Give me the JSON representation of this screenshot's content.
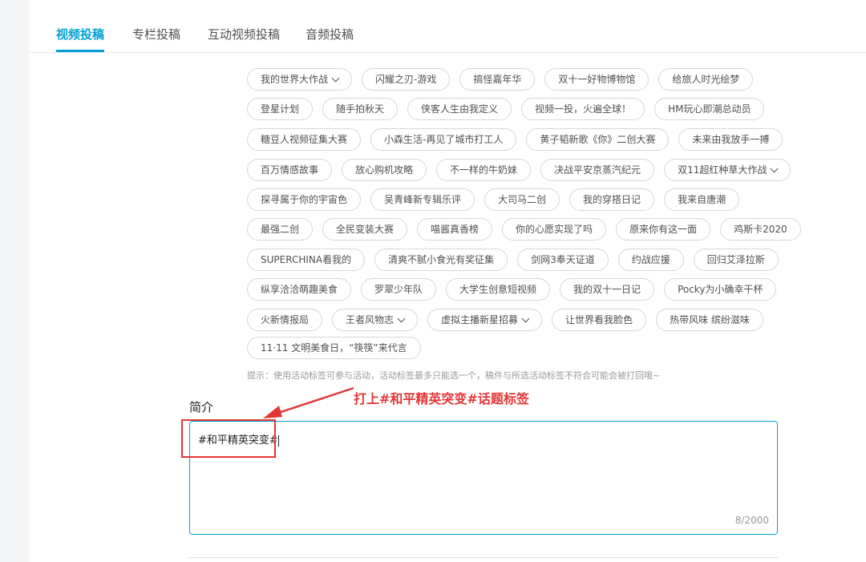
{
  "tabs": [
    {
      "label": "视频投稿"
    },
    {
      "label": "专栏投稿"
    },
    {
      "label": "互动视频投稿"
    },
    {
      "label": "音频投稿"
    }
  ],
  "tag_rows": [
    [
      {
        "label": "我的世界大作战",
        "dropdown": true
      },
      {
        "label": "闪耀之刃-游戏"
      },
      {
        "label": "搞怪嘉年华"
      },
      {
        "label": "双十一好物博物馆"
      },
      {
        "label": "给旅人时光绘梦"
      }
    ],
    [
      {
        "label": "登星计划"
      },
      {
        "label": "随手拍秋天"
      },
      {
        "label": "侠客人生由我定义"
      },
      {
        "label": "视频一投，火遍全球！"
      },
      {
        "label": "HM玩心即潮总动员"
      }
    ],
    [
      {
        "label": "糖豆人视频征集大赛"
      },
      {
        "label": "小森生活-再见了城市打工人"
      },
      {
        "label": "黄子韬新歌《你》二创大赛"
      },
      {
        "label": "未来由我放手一搏"
      }
    ],
    [
      {
        "label": "百万情感故事"
      },
      {
        "label": "放心购机攻略"
      },
      {
        "label": "不一样的牛奶妹"
      },
      {
        "label": "决战平安京蒸汽纪元"
      },
      {
        "label": "双11超红种草大作战",
        "dropdown": true
      }
    ],
    [
      {
        "label": "探寻属于你的宇宙色"
      },
      {
        "label": "吴青峰新专辑乐评"
      },
      {
        "label": "大司马二创"
      },
      {
        "label": "我的穿搭日记"
      },
      {
        "label": "我来自唐潮"
      }
    ],
    [
      {
        "label": "最强二创"
      },
      {
        "label": "全民变装大赛"
      },
      {
        "label": "喵酱真香榜"
      },
      {
        "label": "你的心愿实现了吗"
      },
      {
        "label": "原来你有这一面"
      },
      {
        "label": "鸡斯卡2020"
      }
    ],
    [
      {
        "label": "SUPERCHINA看我的"
      },
      {
        "label": "清爽不腻小食光有奖征集"
      },
      {
        "label": "剑网3奉天证道"
      },
      {
        "label": "约战应援"
      },
      {
        "label": "回归艾泽拉斯"
      }
    ],
    [
      {
        "label": "纵享洽洽萌趣美食"
      },
      {
        "label": "罗翠少年队"
      },
      {
        "label": "大学生创意短视频"
      },
      {
        "label": "我的双十一日记"
      },
      {
        "label": "Pocky为小确幸干杯"
      }
    ],
    [
      {
        "label": "火新情报局"
      },
      {
        "label": "王者风物志",
        "dropdown": true
      },
      {
        "label": "虚拟主播新星招募",
        "dropdown": true
      },
      {
        "label": "让世界看我脸色"
      },
      {
        "label": "热带风味 缤纷滋味"
      }
    ],
    [
      {
        "label": "11·11 文明美食日，“筷筷”来代言"
      }
    ]
  ],
  "hint": "提示：使用活动标签可参与活动，活动标签最多只能选一个，稿件与所选活动标签不符合可能会被打回哦~",
  "description": {
    "label": "简介",
    "value": "#和平精英突变#",
    "count": "8/2000"
  },
  "annotation": {
    "text": "打上#和平精英突变#话题标签"
  },
  "colors": {
    "accent": "#00a1d6",
    "annotation": "#e33636"
  }
}
